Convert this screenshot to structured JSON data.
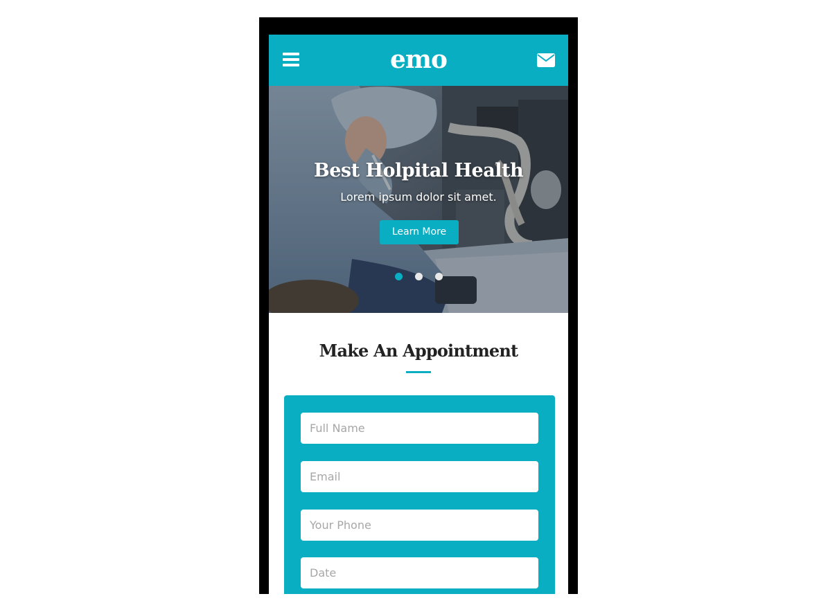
{
  "navbar": {
    "brand": "emo",
    "menu_icon": "hamburger-menu-icon",
    "mail_icon": "envelope-icon",
    "color": "#0aaec3"
  },
  "hero": {
    "title": "Best Holpital Health",
    "subtitle": "Lorem ipsum dolor sit amet.",
    "button_label": "Learn More",
    "slides": 3,
    "active_slide": 1
  },
  "appointment": {
    "title": "Make An Appointment",
    "fields": [
      {
        "placeholder": "Full Name",
        "value": ""
      },
      {
        "placeholder": "Email",
        "value": ""
      },
      {
        "placeholder": "Your Phone",
        "value": ""
      },
      {
        "placeholder": "Date",
        "value": ""
      }
    ]
  },
  "colors": {
    "accent": "#0aaec3",
    "heading": "#222222",
    "device_frame": "#000000"
  }
}
